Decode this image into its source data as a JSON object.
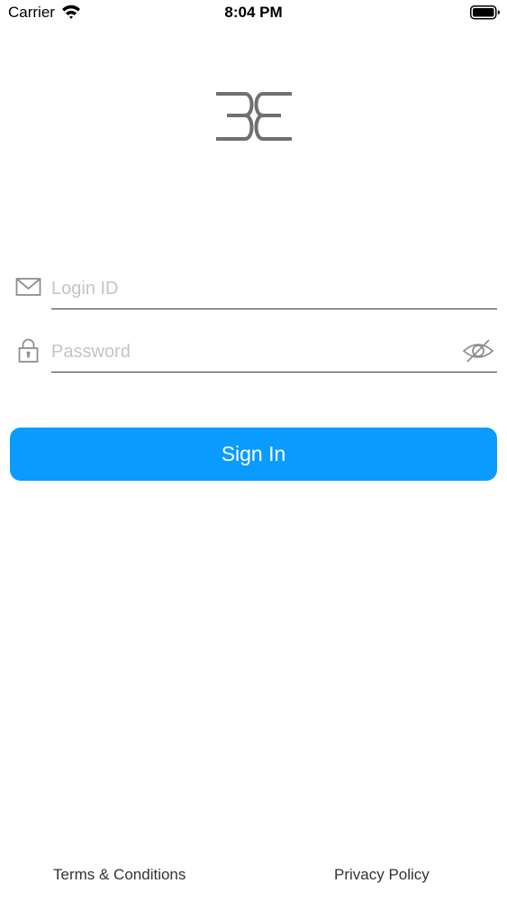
{
  "status_bar": {
    "carrier": "Carrier",
    "time": "8:04 PM"
  },
  "icons": {
    "wifi": "wifi-icon",
    "battery": "battery-icon",
    "logo": "logo",
    "email": "envelope-icon",
    "lock": "lock-icon",
    "eye": "eye-slash-icon"
  },
  "form": {
    "login": {
      "placeholder": "Login ID",
      "value": ""
    },
    "password": {
      "placeholder": "Password",
      "value": ""
    },
    "sign_in_label": "Sign In"
  },
  "footer": {
    "terms_label": "Terms & Conditions",
    "privacy_label": "Privacy Policy"
  },
  "colors": {
    "primary": "#0a9bff",
    "logo": "#707070",
    "underline": "#3c3c3c",
    "placeholder": "#c4c4c8"
  }
}
